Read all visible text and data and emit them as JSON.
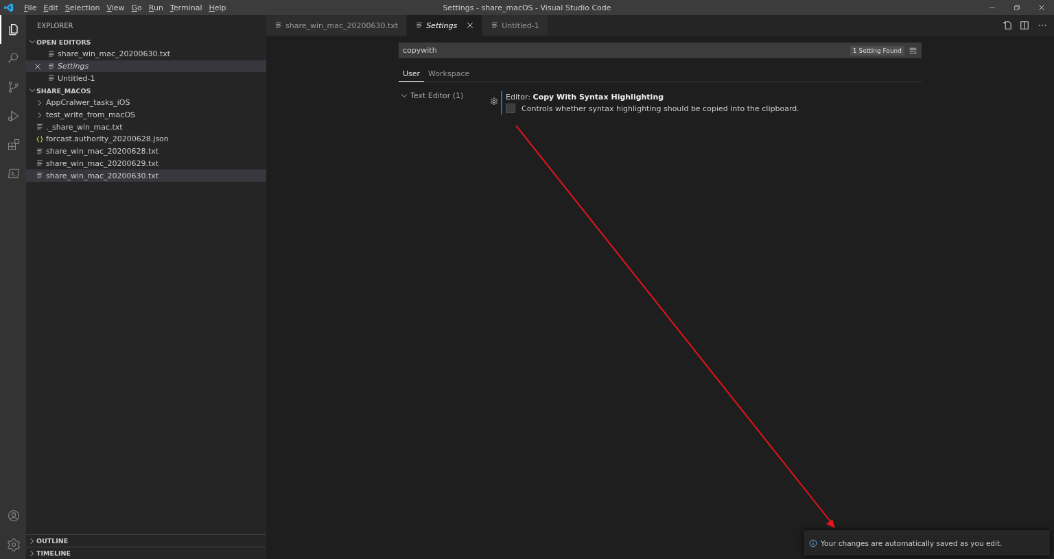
{
  "window": {
    "title": "Settings - share_macOS - Visual Studio Code"
  },
  "menu": [
    "File",
    "Edit",
    "Selection",
    "View",
    "Go",
    "Run",
    "Terminal",
    "Help"
  ],
  "activity_bar": [
    {
      "kind": "files",
      "selected": true
    },
    {
      "kind": "search",
      "selected": false
    },
    {
      "kind": "source-control",
      "selected": false
    },
    {
      "kind": "run",
      "selected": false
    },
    {
      "kind": "extensions",
      "selected": false
    },
    {
      "kind": "terminal",
      "selected": false
    }
  ],
  "sidebar": {
    "title": "EXPLORER",
    "sections": [
      {
        "title": "OPEN EDITORS",
        "expanded": true,
        "items": [
          {
            "label": "share_win_mac_20200630.txt",
            "kind": "txt",
            "italic": false,
            "selected": false
          },
          {
            "label": "Settings",
            "kind": "txt",
            "italic": true,
            "selected": true
          },
          {
            "label": "Untitled-1",
            "kind": "txt",
            "italic": false,
            "selected": false
          }
        ]
      },
      {
        "title": "SHARE_MACOS",
        "expanded": true,
        "items": [
          {
            "label": "AppCralwer_tasks_iOS",
            "kind": "folder",
            "expanded": false,
            "selected": false
          },
          {
            "label": "test_write_from_macOS",
            "kind": "folder",
            "expanded": false,
            "selected": false
          },
          {
            "label": "._share_win_mac.txt",
            "kind": "txt",
            "selected": false
          },
          {
            "label": "forcast.authority_20200628.json",
            "kind": "json",
            "selected": false
          },
          {
            "label": "share_win_mac_20200628.txt",
            "kind": "txt",
            "selected": false
          },
          {
            "label": "share_win_mac_20200629.txt",
            "kind": "txt",
            "selected": false
          },
          {
            "label": "share_win_mac_20200630.txt",
            "kind": "txt",
            "selected": true
          }
        ]
      }
    ],
    "bottom_sections": [
      {
        "title": "OUTLINE",
        "expanded": false
      },
      {
        "title": "TIMELINE",
        "expanded": false
      }
    ]
  },
  "tabs": [
    {
      "label": "share_win_mac_20200630.txt",
      "italic": false,
      "selected": false
    },
    {
      "label": "Settings",
      "italic": true,
      "selected": true
    },
    {
      "label": "Untitled-1",
      "italic": false,
      "selected": false
    }
  ],
  "settings": {
    "search": {
      "value": "copywith"
    },
    "result_count": "1 Setting Found",
    "scopes": [
      {
        "label": "User",
        "selected": true
      },
      {
        "label": "Workspace",
        "selected": false
      }
    ],
    "toc": [
      {
        "label": "Text Editor (1)",
        "expanded": true
      }
    ],
    "items": [
      {
        "category": "Editor:",
        "title": "Copy With Syntax Highlighting",
        "description": "Controls whether syntax highlighting should be copied into the clipboard.",
        "checked": false
      }
    ]
  },
  "notification": {
    "text": "Your changes are automatically saved as you edit."
  }
}
